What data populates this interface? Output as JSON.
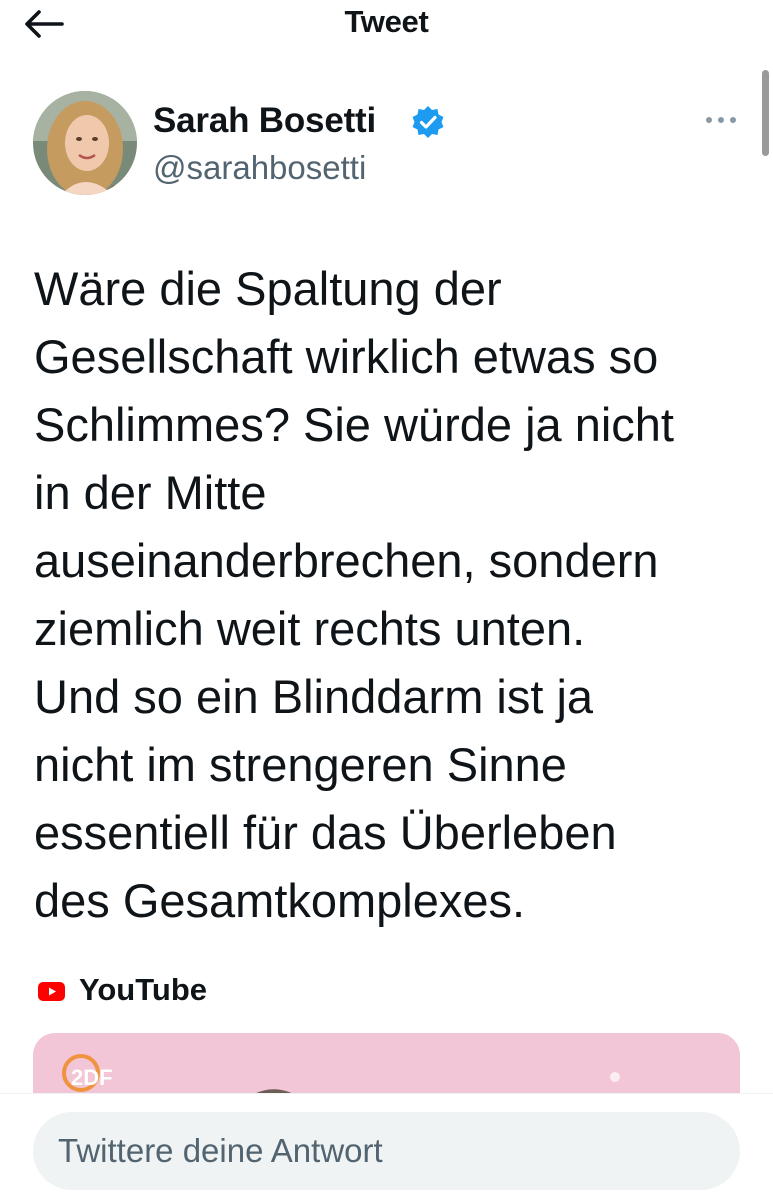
{
  "header": {
    "title": "Tweet",
    "back_icon": "arrow-left-icon"
  },
  "tweet": {
    "author_name": "Sarah Bosetti",
    "author_handle": "@sarahbosetti",
    "verified_icon": "verified-badge-icon",
    "more_icon": "more-horizontal-icon",
    "text": "Wäre die Spaltung der\nGesellschaft wirklich etwas so\nSchlimmes? Sie würde ja nicht\nin der Mitte\nauseinanderbrechen, sondern\nziemlich weit rechts unten.\nUnd so ein Blinddarm ist ja\nnicht im strengeren Sinne\nessentiell für das Überleben\ndes Gesamtkomplexes."
  },
  "embed": {
    "source_label": "YouTube",
    "source_icon": "youtube-icon",
    "card_logo": "2DF"
  },
  "reply": {
    "placeholder": "Twittere deine Antwort"
  },
  "colors": {
    "text": "#0f1419",
    "secondary": "#536471",
    "verified": "#1d9bf0",
    "youtube": "#ff0000",
    "card_bg": "#f2c6d6",
    "zdf_orange": "#f08a24",
    "reply_bg": "#eff3f4"
  }
}
